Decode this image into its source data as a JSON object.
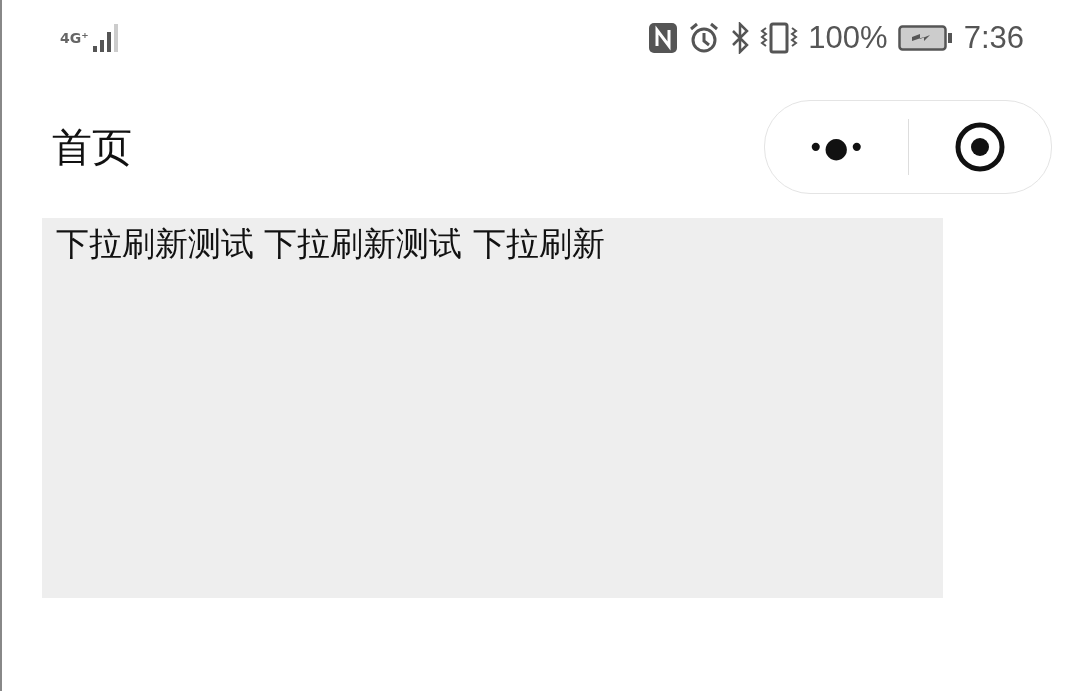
{
  "status_bar": {
    "network": "4G⁺",
    "battery_percent": "100%",
    "time": "7:36"
  },
  "nav_bar": {
    "title": "首页",
    "more_button": "•●•"
  },
  "content": {
    "text": "下拉刷新测试 下拉刷新测试 下拉刷新"
  }
}
